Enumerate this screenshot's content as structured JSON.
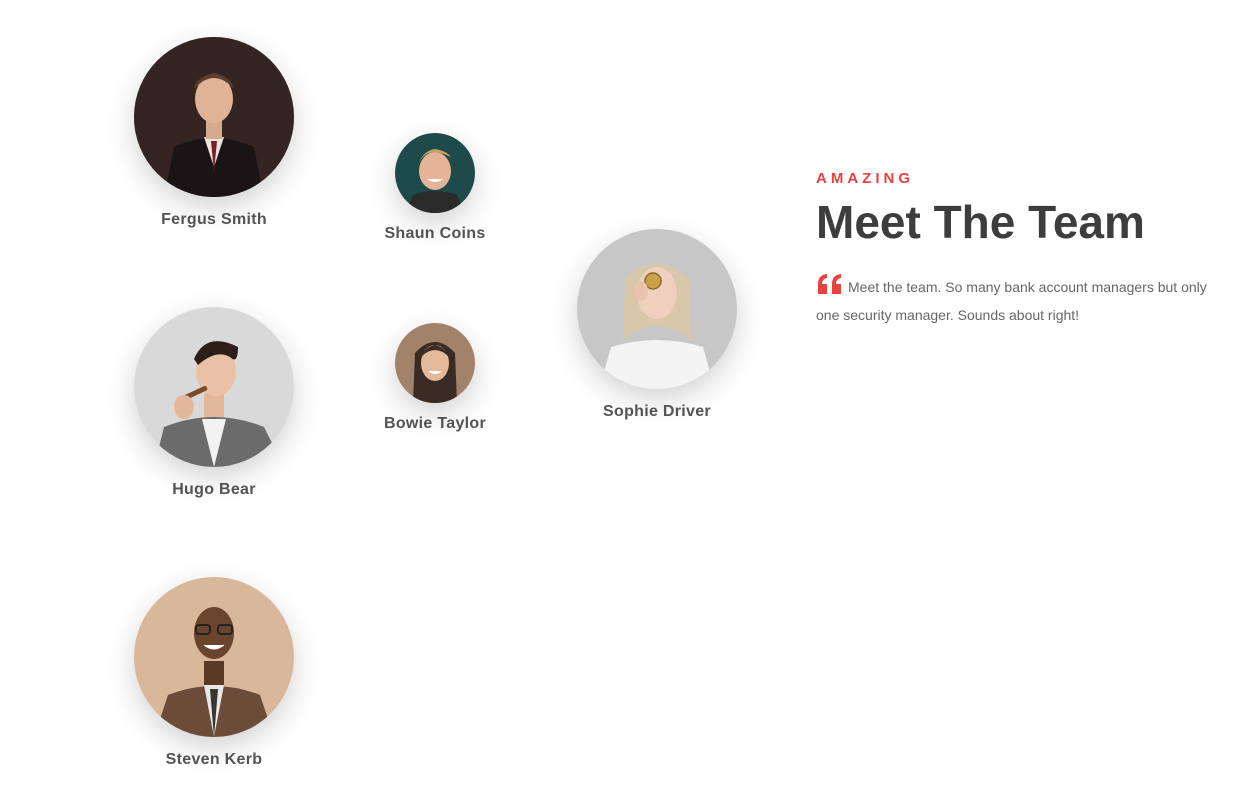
{
  "team": [
    {
      "id": "fergus",
      "name": "Fergus Smith"
    },
    {
      "id": "hugo",
      "name": "Hugo Bear"
    },
    {
      "id": "steven",
      "name": "Steven Kerb"
    },
    {
      "id": "shaun",
      "name": "Shaun Coins"
    },
    {
      "id": "bowie",
      "name": "Bowie Taylor"
    },
    {
      "id": "sophie",
      "name": "Sophie Driver"
    }
  ],
  "intro": {
    "eyebrow": "AMAZING",
    "heading": "Meet The Team",
    "quote": "Meet the team. So many bank account managers but only one security manager. Sounds about right!",
    "quote_icon": "quote-icon"
  },
  "colors": {
    "accent": "#e8413e",
    "heading": "#3d3d3d",
    "text": "#666666"
  }
}
